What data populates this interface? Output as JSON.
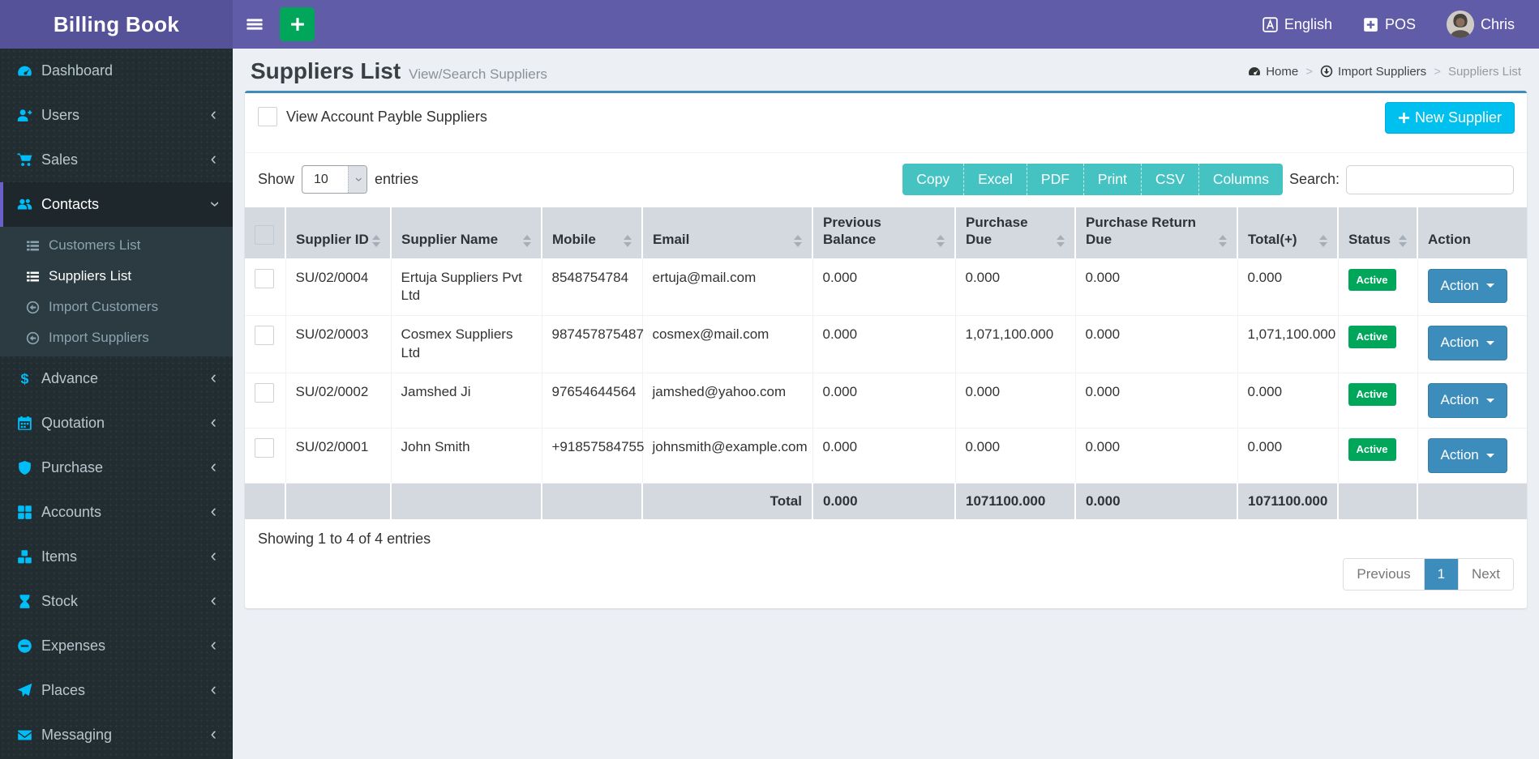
{
  "app": {
    "title": "Billing Book"
  },
  "topbar": {
    "language": "English",
    "pos": "POS",
    "user": "Chris"
  },
  "page": {
    "title": "Suppliers List",
    "subtitle": "View/Search Suppliers",
    "breadcrumb": [
      {
        "label": "Home",
        "icon": "dashboard-icon"
      },
      {
        "label": "Import Suppliers",
        "icon": "import-down-icon"
      },
      {
        "label": "Suppliers List"
      }
    ]
  },
  "sidebar": {
    "items": [
      {
        "label": "Dashboard",
        "icon": "dashboard-icon"
      },
      {
        "label": "Users",
        "icon": "user-plus-icon",
        "chevron": true
      },
      {
        "label": "Sales",
        "icon": "cart-icon",
        "chevron": true
      },
      {
        "label": "Contacts",
        "icon": "users-icon",
        "active": true,
        "expanded": true,
        "submenu": [
          {
            "label": "Customers List",
            "icon": "list-icon"
          },
          {
            "label": "Suppliers List",
            "icon": "list-icon",
            "active": true
          },
          {
            "label": "Import Customers",
            "icon": "import-left-icon"
          },
          {
            "label": "Import Suppliers",
            "icon": "import-left-icon"
          }
        ]
      },
      {
        "label": "Advance",
        "icon": "dollar-icon",
        "chevron": true
      },
      {
        "label": "Quotation",
        "icon": "calendar-icon",
        "chevron": true
      },
      {
        "label": "Purchase",
        "icon": "shield-icon",
        "chevron": true
      },
      {
        "label": "Accounts",
        "icon": "grid-icon",
        "chevron": true
      },
      {
        "label": "Items",
        "icon": "cubes-icon",
        "chevron": true
      },
      {
        "label": "Stock",
        "icon": "hourglass-icon",
        "chevron": true
      },
      {
        "label": "Expenses",
        "icon": "minus-circle-icon",
        "chevron": true
      },
      {
        "label": "Places",
        "icon": "paper-plane-icon",
        "chevron": true
      },
      {
        "label": "Messaging",
        "icon": "envelope-icon",
        "chevron": true
      }
    ]
  },
  "card": {
    "filter_label": "View Account Payble Suppliers",
    "new_supplier_label": "New Supplier",
    "show_label": "Show",
    "page_length": "10",
    "entries_label": "entries",
    "export_buttons": [
      "Copy",
      "Excel",
      "PDF",
      "Print",
      "CSV",
      "Columns"
    ],
    "search_label": "Search:",
    "table": {
      "columns": [
        "",
        "Supplier ID",
        "Supplier Name",
        "Mobile",
        "Email",
        "Previous Balance",
        "Purchase Due",
        "Purchase Return Due",
        "Total(+)",
        "Status",
        "Action"
      ],
      "rows": [
        {
          "id": "SU/02/0004",
          "name": "Ertuja Suppliers Pvt Ltd",
          "mobile": "8548754784",
          "email": "ertuja@mail.com",
          "previous_balance": "0.000",
          "purchase_due": "0.000",
          "purchase_return_due": "0.000",
          "total": "0.000",
          "status": "Active",
          "action": "Action"
        },
        {
          "id": "SU/02/0003",
          "name": "Cosmex Suppliers Ltd",
          "mobile": "987457875487",
          "email": "cosmex@mail.com",
          "previous_balance": "0.000",
          "purchase_due": "1,071,100.000",
          "purchase_return_due": "0.000",
          "total": "1,071,100.000",
          "status": "Active",
          "action": "Action"
        },
        {
          "id": "SU/02/0002",
          "name": "Jamshed Ji",
          "mobile": "97654644564",
          "email": "jamshed@yahoo.com",
          "previous_balance": "0.000",
          "purchase_due": "0.000",
          "purchase_return_due": "0.000",
          "total": "0.000",
          "status": "Active",
          "action": "Action"
        },
        {
          "id": "SU/02/0001",
          "name": "John Smith",
          "mobile": "+91857584755",
          "email": "johnsmith@example.com",
          "previous_balance": "0.000",
          "purchase_due": "0.000",
          "purchase_return_due": "0.000",
          "total": "0.000",
          "status": "Active",
          "action": "Action"
        }
      ],
      "total_row": {
        "label": "Total",
        "previous_balance": "0.000",
        "purchase_due": "1071100.000",
        "purchase_return_due": "0.000",
        "total": "1071100.000"
      }
    },
    "footer": {
      "showing_text": "Showing 1 to 4 of 4 entries",
      "pagination": {
        "previous": "Previous",
        "page": "1",
        "next": "Next"
      }
    }
  },
  "colors": {
    "brand_purple": "#605ca8",
    "logo_purple": "#555299",
    "sidebar_dark": "#222d32",
    "accent_cyan": "#00c0ef",
    "green": "#00a65a",
    "teal_button": "#45c3c3",
    "primary_blue": "#3c8dbc",
    "table_header_bg": "#d4d8df",
    "content_bg": "#ecf0f5"
  }
}
